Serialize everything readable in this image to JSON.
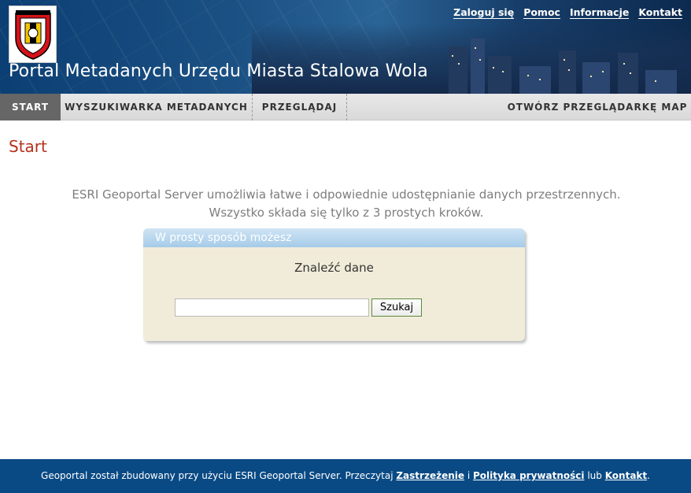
{
  "header": {
    "title": "Portal Metadanych Urzędu Miasta Stalowa Wola",
    "top_links": [
      "Zaloguj się",
      "Pomoc",
      "Informacje",
      "Kontakt"
    ]
  },
  "nav": {
    "tabs": [
      "START",
      "WYSZUKIWARKA METADANYCH",
      "PRZEGLĄDAJ",
      "OTWÓRZ PRZEGLĄDARKĘ MAP"
    ],
    "active": "START"
  },
  "main": {
    "page_title": "Start",
    "intro_line1": "ESRI Geoportal Server umożliwia łatwe i odpowiednie udostępnianie danych przestrzennych.",
    "intro_line2": "Wszystko składa się tylko z 3 prostych kroków.",
    "panel": {
      "header": "W prosty sposób możesz",
      "subtitle": "Znaleźć dane",
      "search_value": "",
      "search_button": "Szukaj"
    }
  },
  "footer": {
    "text_before": "Geoportal został zbudowany przy użyciu ESRI Geoportal Server. Przeczytaj",
    "link_disclaimer": "Zastrzeżenie",
    "and": "i",
    "link_privacy": "Polityka prywatności",
    "or": "lub",
    "link_contact": "Kontakt",
    "end": "."
  },
  "colors": {
    "header_bg": "#0c3f73",
    "footer_bg": "#0a4a84",
    "page_title": "#b5311b",
    "panel_bg": "#f1ecd9",
    "panel_header": "#a6cbe8",
    "active_tab": "#666666"
  },
  "icons": {
    "logo": "city-coat-of-arms-logo"
  }
}
